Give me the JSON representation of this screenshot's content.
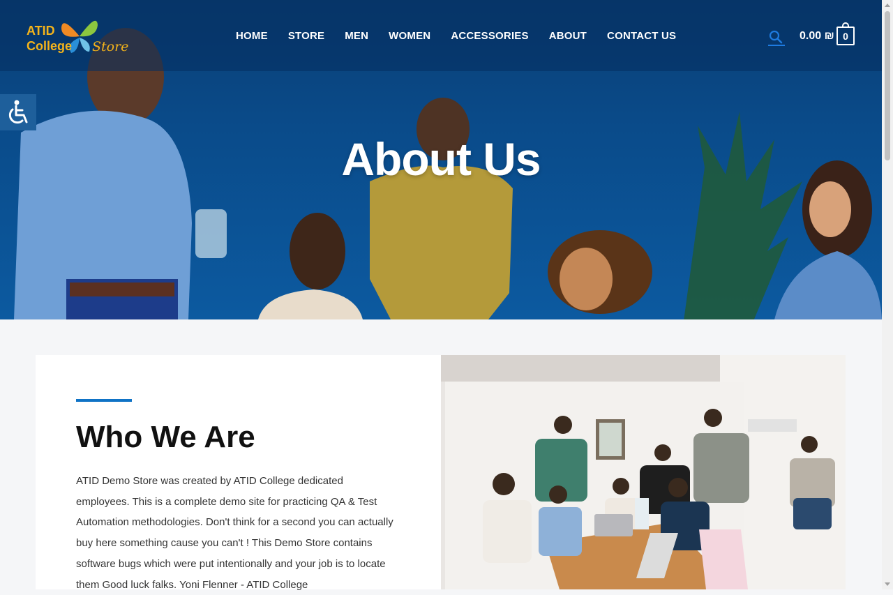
{
  "brand": {
    "logo_line1": "ATID",
    "logo_line2": "College",
    "logo_line3": "Store",
    "logo_color": "#f3b31b",
    "accent": "#0f73c6"
  },
  "nav": {
    "items": [
      "HOME",
      "STORE",
      "MEN",
      "WOMEN",
      "ACCESSORIES",
      "ABOUT",
      "CONTACT US"
    ]
  },
  "header": {
    "search_icon": "search-icon",
    "cart_total": "0.00 ₪",
    "cart_count": "0",
    "cart_icon": "shopping-bag-icon"
  },
  "accessibility": {
    "icon": "wheelchair-icon"
  },
  "hero": {
    "title": "About Us"
  },
  "about": {
    "title": "Who We Are",
    "text": "ATID Demo Store was created by ATID College dedicated employees. This is a complete demo site for practicing QA & Test Automation methodologies. Don't think for a second you can actually buy here something cause you can't ! This Demo Store contains software bugs which were put intentionally and your job is to locate them Good luck falks. Yoni Flenner - ATID College"
  }
}
